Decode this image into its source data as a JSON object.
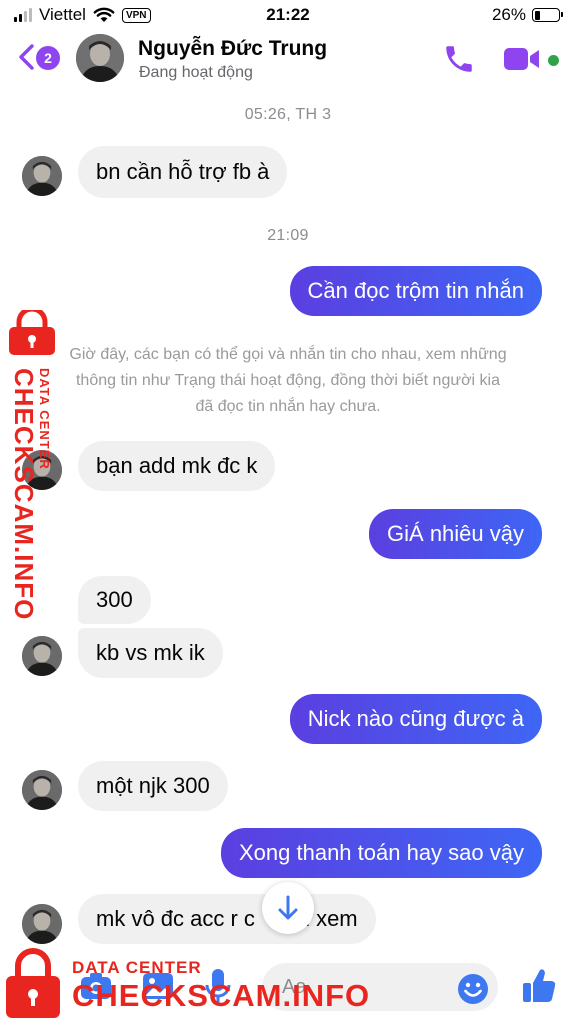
{
  "status_bar": {
    "carrier": "Viettel",
    "vpn": "VPN",
    "time": "21:22",
    "battery": "26%",
    "battery_level": 0.26
  },
  "header": {
    "badge_count": "2",
    "contact_name": "Nguyễn Đức Trung",
    "contact_status": "Đang hoạt động",
    "accent_color": "#8e44ef",
    "online_color": "#31a24c"
  },
  "chat": {
    "timestamp_1": "05:26, TH 3",
    "msg_1": "bn cần hỗ trợ fb à",
    "timestamp_2": "21:09",
    "msg_2": "Cần đọc trộm tin nhắn",
    "system_notice_line1": "Giờ đây, các bạn có thể gọi và nhắn tin cho nhau, xem những",
    "system_notice_line2": "thông tin như Trạng thái hoạt động, đồng thời biết người kia",
    "system_notice_line3": "đã đọc tin nhắn hay chưa.",
    "msg_3": "bạn add mk đc k",
    "msg_4": "GiÁ nhiêu vậy",
    "msg_5": "300",
    "msg_6": "kb vs mk ik",
    "msg_7": "Nick nào cũng được à",
    "msg_8": "một njk 300",
    "msg_9": "Xong thanh toán hay sao vậy",
    "msg_10": "mk vô đc acc r c     bn xem"
  },
  "composer": {
    "placeholder": "Aa"
  },
  "watermark": {
    "side_main": "CHECKSCAM.INFO",
    "side_sub": "DATA CENTER",
    "bottom_sub": "DATA CENTER",
    "bottom_main": "CHECKSCAM.INFO",
    "color": "#e8261f"
  },
  "icons": [
    "back-chevron-icon",
    "phone-icon",
    "video-camera-icon",
    "arrow-down-icon",
    "camera-icon",
    "image-icon",
    "microphone-icon",
    "emoji-icon",
    "thumbs-up-icon",
    "padlock-icon"
  ]
}
